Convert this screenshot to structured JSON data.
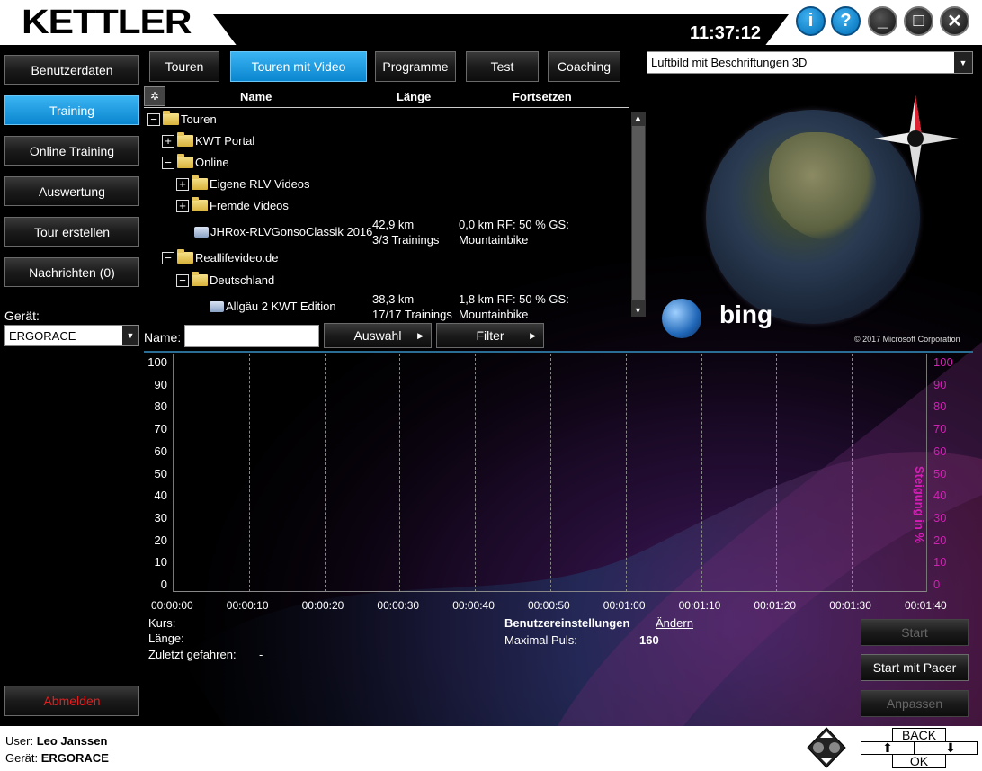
{
  "app": {
    "brand": "KETTLER",
    "clock": "11:37:12"
  },
  "header_buttons": {
    "info": "i",
    "help": "?",
    "minimize": "_",
    "maximize": "□",
    "close": "✕"
  },
  "sidebar": {
    "items": [
      {
        "label": "Benutzerdaten",
        "active": false
      },
      {
        "label": "Training",
        "active": true
      },
      {
        "label": "Online Training",
        "active": false
      },
      {
        "label": "Auswertung",
        "active": false
      },
      {
        "label": "Tour erstellen",
        "active": false
      },
      {
        "label": "Nachrichten (0)",
        "active": false
      }
    ],
    "device_label": "Gerät:",
    "device_value": "ERGORACE",
    "logout": "Abmelden"
  },
  "tabs": [
    {
      "label": "Touren",
      "active": false
    },
    {
      "label": "Touren mit Video",
      "active": true
    },
    {
      "label": "Programme",
      "active": false
    },
    {
      "label": "Test",
      "active": false
    },
    {
      "label": "Coaching",
      "active": false
    }
  ],
  "map": {
    "view_select": "Luftbild mit Beschriftungen 3D",
    "provider": "bing",
    "copyright": "© 2017 Microsoft Corporation"
  },
  "tree": {
    "columns": {
      "name": "Name",
      "length": "Länge",
      "resume": "Fortsetzen"
    },
    "nodes": {
      "touren": "Touren",
      "kwt_portal": "KWT Portal",
      "online": "Online",
      "eigene": "Eigene RLV Videos",
      "fremde": "Fremde Videos",
      "reallife": "Reallifevideo.de",
      "deutschland": "Deutschland"
    },
    "items": [
      {
        "name": "JHRox-RLVGonsoClassik 2016",
        "length": "42,9 km",
        "trainings": "3/3 Trainings",
        "resume": "0,0 km RF: 50 %  GS:",
        "type": "Mountainbike"
      },
      {
        "name": "Allgäu 2 KWT Edition",
        "length": "38,3 km",
        "trainings": "17/17 Trainings",
        "resume": "1,8 km RF: 50 %  GS:",
        "type": "Mountainbike"
      }
    ]
  },
  "filter": {
    "name_label": "Name:",
    "name_value": "",
    "auswahl": "Auswahl",
    "filter": "Filter"
  },
  "chart_data": {
    "type": "line",
    "y_left_ticks": [
      "100",
      "90",
      "80",
      "70",
      "60",
      "50",
      "40",
      "30",
      "20",
      "10",
      "0"
    ],
    "y_right_ticks": [
      "100",
      "90",
      "80",
      "70",
      "60",
      "50",
      "40",
      "30",
      "20",
      "10",
      "0"
    ],
    "ylabel_right": "Steigung in %",
    "x_ticks": [
      "00:00:00",
      "00:00:10",
      "00:00:20",
      "00:00:30",
      "00:00:40",
      "00:00:50",
      "00:01:00",
      "00:01:10",
      "00:01:20",
      "00:01:30",
      "00:01:40"
    ],
    "series": [],
    "ylim": [
      0,
      100
    ]
  },
  "details": {
    "kurs": "Kurs:",
    "laenge": "Länge:",
    "zuletzt": "Zuletzt gefahren:",
    "zuletzt_value": "-",
    "settings_title": "Benutzereinstellungen",
    "change": "Ändern",
    "max_puls_label": "Maximal Puls:",
    "max_puls_value": "160"
  },
  "actions": {
    "start": "Start",
    "start_pacer": "Start mit Pacer",
    "anpassen": "Anpassen"
  },
  "footer": {
    "user_label": "User:",
    "user_value": "Leo Janssen",
    "device_label": "Gerät:",
    "device_value": "ERGORACE",
    "back": "BACK",
    "ok": "OK",
    "up": "⬆",
    "down": "⬇"
  }
}
